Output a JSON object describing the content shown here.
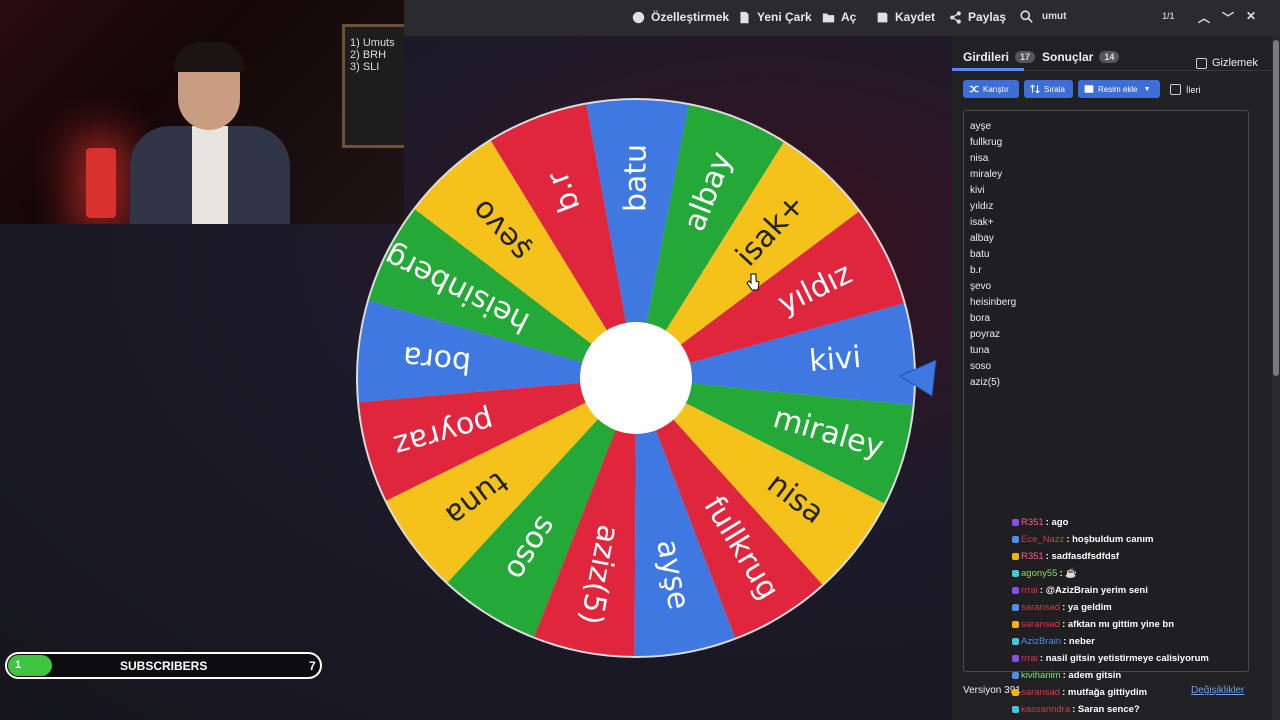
{
  "toolbar": {
    "customize": "Özelleştirmek",
    "new_wheel": "Yeni Çark",
    "open": "Aç",
    "save": "Kaydet",
    "share": "Paylaş",
    "search_value": "umut",
    "search_count": "1/1"
  },
  "webcam": {
    "board_lines": [
      "1) Umuts",
      "2) BRH",
      "3) SLI"
    ]
  },
  "wheel": {
    "segments": [
      {
        "label": "kivi",
        "color": "#3e78e0"
      },
      {
        "label": "yıldız",
        "color": "#e0263d"
      },
      {
        "label": "isak+",
        "color": "#f4c21b"
      },
      {
        "label": "albay",
        "color": "#24a838"
      },
      {
        "label": "batu",
        "color": "#3e78e0"
      },
      {
        "label": "b.r",
        "color": "#e0263d"
      },
      {
        "label": "şevo",
        "color": "#f4c21b"
      },
      {
        "label": "heisinberg",
        "color": "#24a838"
      },
      {
        "label": "bora",
        "color": "#3e78e0"
      },
      {
        "label": "poyraz",
        "color": "#e0263d"
      },
      {
        "label": "tuna",
        "color": "#f4c21b"
      },
      {
        "label": "soso",
        "color": "#24a838"
      },
      {
        "label": "aziz(5)",
        "color": "#e0263d"
      },
      {
        "label": "ayşe",
        "color": "#3e78e0"
      },
      {
        "label": "fullkrug",
        "color": "#e0263d"
      },
      {
        "label": "nisa",
        "color": "#f4c21b"
      },
      {
        "label": "miraley",
        "color": "#24a838"
      }
    ]
  },
  "panel": {
    "tab_entries": "Girdileri",
    "tab_entries_count": "17",
    "tab_results": "Sonuçlar",
    "tab_results_count": "14",
    "hide_label": "Gizlemek",
    "shuffle": "Karıştır",
    "sort": "Sırala",
    "add_image": "Resim ekle",
    "advanced": "İleri",
    "entries": [
      "ayşe",
      "fullkrug",
      "nisa",
      "miraley",
      "kivi",
      "yıldız",
      "isak+",
      "albay",
      "batu",
      "b.r",
      "şevo",
      "heisinberg",
      "bora",
      "poyraz",
      "tuna",
      "soso",
      "aziz(5)"
    ],
    "version": "Versiyon 391",
    "changes": "Değişiklikler"
  },
  "chat": [
    {
      "user": "R351",
      "msg": ": ago",
      "color": "#ff5c8a"
    },
    {
      "user": "Ece_Nazz",
      "msg": ": hoşbuldum canım",
      "color": "#d9364a"
    },
    {
      "user": "R351",
      "msg": ": sadfasdfsdfdsf",
      "color": "#ff5c8a"
    },
    {
      "user": "agony55",
      "msg": ": ☕",
      "color": "#8bd95c"
    },
    {
      "user": "rrrai",
      "msg": ": @AzizBrain yerim seni",
      "color": "#d9364a"
    },
    {
      "user": "saransad",
      "msg": ": ya geldim",
      "color": "#d9364a"
    },
    {
      "user": "saransad",
      "msg": ": afktan mı gittim yine bn",
      "color": "#d9364a"
    },
    {
      "user": "AzizBrain",
      "msg": ": neber",
      "color": "#4a8ff0"
    },
    {
      "user": "rrrai",
      "msg": ": nasil gitsin yetistirmeye calisiyorum",
      "color": "#d9364a"
    },
    {
      "user": "kivihanim",
      "msg": ": adem gitsin",
      "color": "#7ee07e"
    },
    {
      "user": "saransad",
      "msg": ": mutfağa gittiydim",
      "color": "#d9364a"
    },
    {
      "user": "kassanndra",
      "msg": ": Saran sence?",
      "color": "#d9364a"
    }
  ],
  "subscribers": {
    "current": "1",
    "label": "SUBSCRIBERS",
    "goal": "7",
    "progress": 0.14
  }
}
